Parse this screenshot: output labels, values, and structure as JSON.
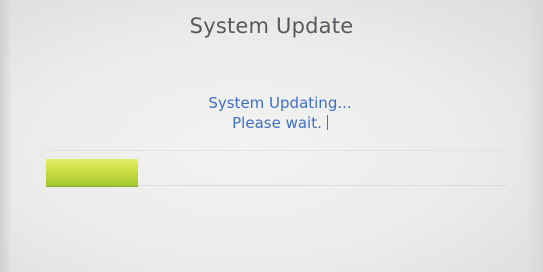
{
  "screen": {
    "title": "System Update",
    "message_line1": "System Updating...",
    "message_line2": "Please wait.",
    "progress": {
      "fraction": 0.2,
      "color": "#c8de3f"
    },
    "accent_color": "#3f6fc7"
  }
}
